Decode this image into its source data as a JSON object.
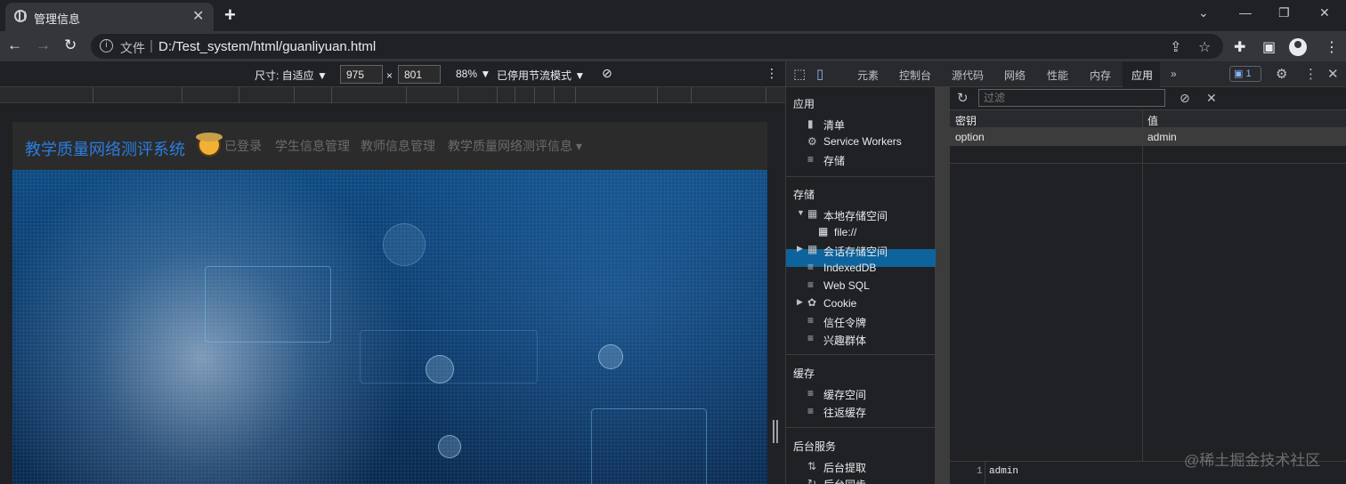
{
  "browser": {
    "tab_title": "管理信息",
    "tab_close": "✕",
    "new_tab": "+",
    "window_controls": [
      "⌄",
      "—",
      "❐",
      "✕"
    ],
    "nav": [
      "←",
      "→",
      "↻"
    ],
    "scheme_label": "文件",
    "separator": "|",
    "url": "D:/Test_system/html/guanliyuan.html",
    "omnibox_icons": [
      "share-icon",
      "star-icon"
    ],
    "toolbar_icons": [
      "extensions-icon",
      "sidepanel-icon",
      "profile-icon",
      "menu-icon"
    ]
  },
  "device_toolbar": {
    "size_label": "尺寸: 自适应 ▼",
    "width": "975",
    "times": "×",
    "height": "801",
    "zoom": "88% ▼",
    "throttle": "已停用节流模式 ▼",
    "rotate": "⊘",
    "more": "⋮"
  },
  "page": {
    "brand": "教学质量网络测评系统",
    "nav_links": [
      "已登录",
      "学生信息管理",
      "教师信息管理",
      "教学质量网络测评信息 ▾"
    ]
  },
  "devtools": {
    "tabs": [
      "元素",
      "控制台",
      "源代码",
      "网络",
      "性能",
      "内存",
      "应用"
    ],
    "active_tab": "应用",
    "more_tabs": "»",
    "issues_count": "1",
    "sidebar": {
      "app_head": "应用",
      "app_items": [
        {
          "icon": "▮",
          "label": "清单"
        },
        {
          "icon": "⚙",
          "label": "Service Workers"
        },
        {
          "icon": "≡",
          "label": "存储"
        }
      ],
      "storage_head": "存储",
      "storage_items": [
        {
          "arrow": "▼",
          "icon": "▦",
          "label": "本地存储空间"
        },
        {
          "arrow": "",
          "icon": "▦",
          "label": "file://"
        },
        {
          "arrow": "▶",
          "icon": "▦",
          "label": "会话存储空间"
        },
        {
          "arrow": "",
          "icon": "≡",
          "label": "IndexedDB"
        },
        {
          "arrow": "",
          "icon": "≡",
          "label": "Web SQL"
        },
        {
          "arrow": "▶",
          "icon": "✿",
          "label": "Cookie"
        },
        {
          "arrow": "",
          "icon": "≡",
          "label": "信任令牌"
        },
        {
          "arrow": "",
          "icon": "≡",
          "label": "兴趣群体"
        }
      ],
      "cache_head": "缓存",
      "cache_items": [
        {
          "icon": "≡",
          "label": "缓存空间"
        },
        {
          "icon": "≡",
          "label": "往返缓存"
        }
      ],
      "bg_head": "后台服务",
      "bg_items": [
        {
          "icon": "⇅",
          "label": "后台提取"
        },
        {
          "icon": "↻",
          "label": "后台同步"
        }
      ]
    },
    "filter_placeholder": "过滤",
    "grid": {
      "columns": [
        "密钥",
        "值"
      ],
      "rows": [
        {
          "key": "option",
          "value": "admin"
        }
      ]
    },
    "preview": {
      "line": "1",
      "text": "admin"
    }
  },
  "watermark": "@稀土掘金技术社区"
}
